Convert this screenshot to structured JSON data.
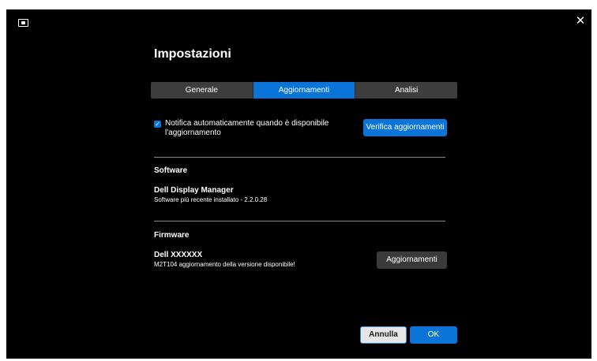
{
  "header": {
    "title": "Impostazioni",
    "close_glyph": "✕",
    "icons": {
      "app": "monitor-icon",
      "close": "close-icon"
    }
  },
  "tabs": [
    {
      "label": "Generale",
      "active": false
    },
    {
      "label": "Aggiornamenti",
      "active": true
    },
    {
      "label": "Analisi",
      "active": false
    }
  ],
  "auto_notify": {
    "checked": true,
    "label": "Notifica automaticamente quando è disponibile l'aggiornamento"
  },
  "check_button_label": "Verifica aggiornamenti",
  "software": {
    "section_title": "Software",
    "name": "Dell Display Manager",
    "status": "Software più recente installato - 2.2.0.28"
  },
  "firmware": {
    "section_title": "Firmware",
    "name": "Dell XXXXXX",
    "status": "M2T104 aggiornamento della versione disponibile!",
    "update_button_label": "Aggiornamenti"
  },
  "footer": {
    "cancel_label": "Annulla",
    "ok_label": "OK"
  },
  "colors": {
    "background": "#000000",
    "accent": "#0a74d9",
    "tab_inactive": "#3d3d3d",
    "divider": "#8a8a8a"
  }
}
